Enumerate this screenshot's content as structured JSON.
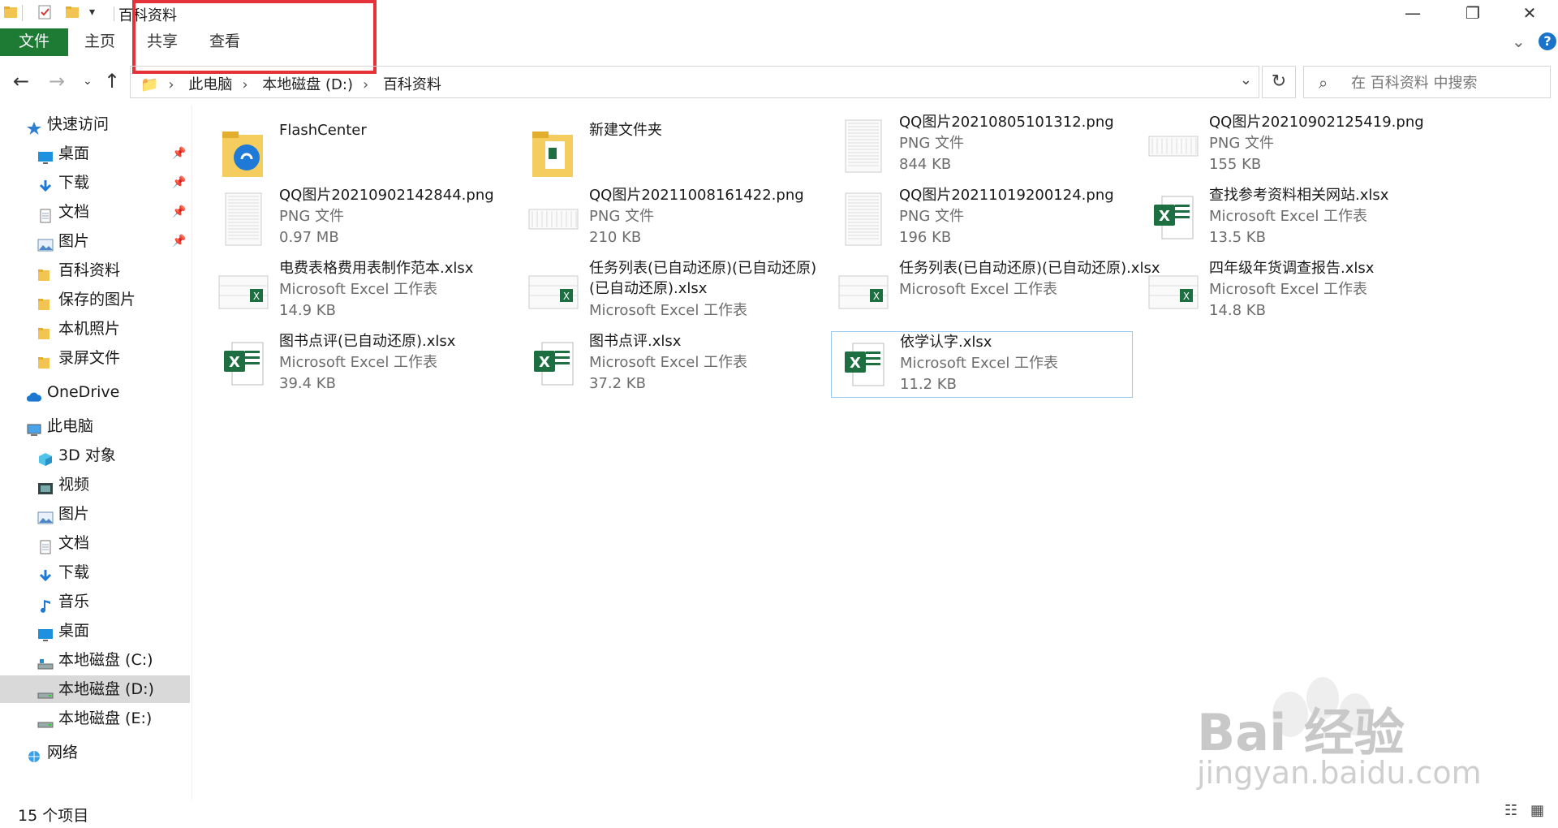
{
  "window": {
    "title": "百科资料",
    "controls": {
      "minimize": "—",
      "maximize": "❐",
      "close": "✕"
    }
  },
  "ribbon": {
    "tabs": [
      "文件",
      "主页",
      "共享",
      "查看"
    ],
    "expand_icon": "chevron-down-icon",
    "help_label": "?"
  },
  "address": {
    "path": [
      "此电脑",
      "本地磁盘 (D:)",
      "百科资料"
    ],
    "search_placeholder": "在 百科资料 中搜索"
  },
  "sidebar": {
    "quick_access": {
      "label": "快速访问",
      "items": [
        {
          "label": "桌面",
          "pinned": true,
          "icon": "desktop-icon"
        },
        {
          "label": "下载",
          "pinned": true,
          "icon": "download-icon"
        },
        {
          "label": "文档",
          "pinned": true,
          "icon": "document-icon"
        },
        {
          "label": "图片",
          "pinned": true,
          "icon": "picture-icon"
        },
        {
          "label": "百科资料",
          "pinned": false,
          "icon": "folder-icon"
        },
        {
          "label": "保存的图片",
          "pinned": false,
          "icon": "folder-icon"
        },
        {
          "label": "本机照片",
          "pinned": false,
          "icon": "folder-icon"
        },
        {
          "label": "录屏文件",
          "pinned": false,
          "icon": "folder-icon"
        }
      ]
    },
    "onedrive": "OneDrive",
    "this_pc": {
      "label": "此电脑",
      "items": [
        {
          "label": "3D 对象",
          "icon": "3d-objects-icon"
        },
        {
          "label": "视频",
          "icon": "video-icon"
        },
        {
          "label": "图片",
          "icon": "picture-icon"
        },
        {
          "label": "文档",
          "icon": "document-icon"
        },
        {
          "label": "下载",
          "icon": "download-icon"
        },
        {
          "label": "音乐",
          "icon": "music-icon"
        },
        {
          "label": "桌面",
          "icon": "desktop-icon"
        },
        {
          "label": "本地磁盘 (C:)",
          "icon": "drive-c-icon"
        },
        {
          "label": "本地磁盘 (D:)",
          "icon": "drive-icon",
          "selected": true
        },
        {
          "label": "本地磁盘 (E:)",
          "icon": "drive-icon"
        }
      ]
    },
    "network": "网络"
  },
  "files": [
    {
      "name": "FlashCenter",
      "type": "",
      "size": "",
      "kind": "folder-app"
    },
    {
      "name": "新建文件夹",
      "type": "",
      "size": "",
      "kind": "folder-xls"
    },
    {
      "name": "QQ图片20210805101312.png",
      "type": "PNG 文件",
      "size": "844 KB",
      "kind": "png-tall"
    },
    {
      "name": "QQ图片20210902125419.png",
      "type": "PNG 文件",
      "size": "155 KB",
      "kind": "png-wide"
    },
    {
      "name": "QQ图片20210902142844.png",
      "type": "PNG 文件",
      "size": "0.97 MB",
      "kind": "png-tall"
    },
    {
      "name": "QQ图片20211008161422.png",
      "type": "PNG 文件",
      "size": "210 KB",
      "kind": "png-wide"
    },
    {
      "name": "QQ图片20211019200124.png",
      "type": "PNG 文件",
      "size": "196 KB",
      "kind": "png-tall"
    },
    {
      "name": "查找参考资料相关网站.xlsx",
      "type": "Microsoft Excel 工作表",
      "size": "13.5 KB",
      "kind": "excel"
    },
    {
      "name": "电费表格费用表制作范本.xlsx",
      "type": "Microsoft Excel 工作表",
      "size": "14.9 KB",
      "kind": "excel-sheet"
    },
    {
      "name": "任务列表(已自动还原)(已自动还原)(已自动还原).xlsx",
      "type": "Microsoft Excel 工作表",
      "size": "",
      "kind": "excel-sheet"
    },
    {
      "name": "任务列表(已自动还原)(已自动还原).xlsx",
      "type": "Microsoft Excel 工作表",
      "size": "",
      "kind": "excel-sheet"
    },
    {
      "name": "四年级年货调查报告.xlsx",
      "type": "Microsoft Excel 工作表",
      "size": "14.8 KB",
      "kind": "excel-sheet"
    },
    {
      "name": "图书点评(已自动还原).xlsx",
      "type": "Microsoft Excel 工作表",
      "size": "39.4 KB",
      "kind": "excel"
    },
    {
      "name": "图书点评.xlsx",
      "type": "Microsoft Excel 工作表",
      "size": "37.2 KB",
      "kind": "excel"
    },
    {
      "name": "依学认字.xlsx",
      "type": "Microsoft Excel 工作表",
      "size": "11.2 KB",
      "kind": "excel",
      "selected": true
    }
  ],
  "status": {
    "count": "15 个项目"
  },
  "watermark": {
    "line1": "Bai 经验",
    "line2": "jingyan.baidu.com"
  },
  "colors": {
    "accent_file_tab": "#1e7b34",
    "excel_green": "#1d6f42",
    "highlight_box": "#e53238",
    "selection": "#99c9ef"
  }
}
